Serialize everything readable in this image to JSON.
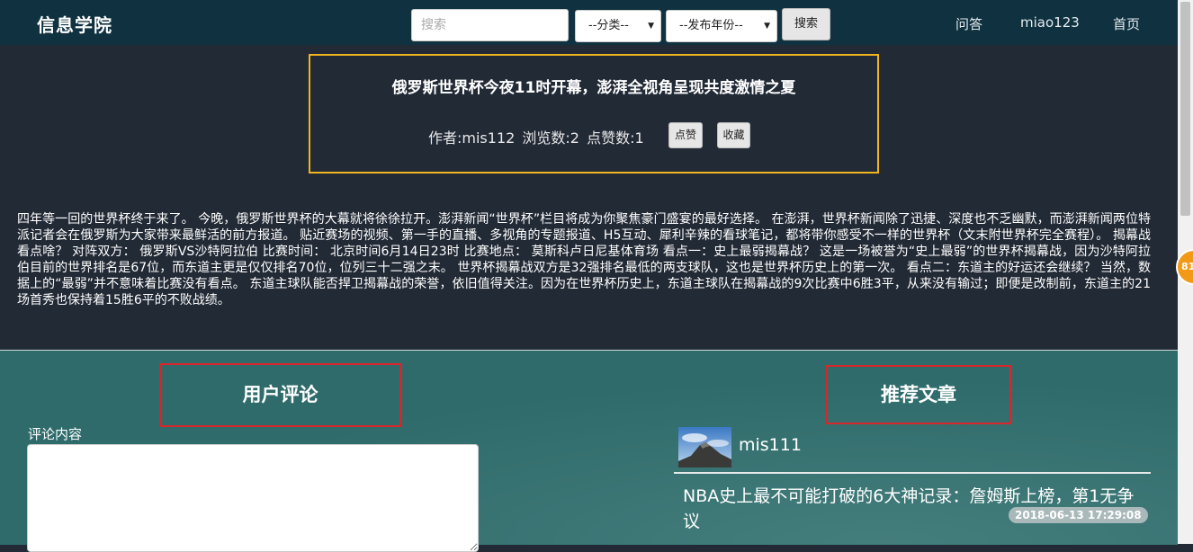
{
  "navbar": {
    "brand": "信息学院",
    "search_placeholder": "搜索",
    "category_select": "--分类--",
    "year_select": "--发布年份--",
    "search_button": "搜索",
    "links": [
      "问答",
      "miao123",
      "首页"
    ]
  },
  "article": {
    "title": "俄罗斯世界杯今夜11时开幕，澎湃全视角呈现共度激情之夏",
    "author_label": "作者:mis112",
    "views_label": "浏览数:2",
    "likes_label": "点赞数:1",
    "like_button": "点赞",
    "favorite_button": "收藏",
    "body": "四年等一回的世界杯终于来了。 今晚，俄罗斯世界杯的大幕就将徐徐拉开。澎湃新闻“世界杯”栏目将成为你聚焦豪门盛宴的最好选择。 在澎湃，世界杯新闻除了迅捷、深度也不乏幽默，而澎湃新闻两位特派记者会在俄罗斯为大家带来最鲜活的前方报道。 贴近赛场的视频、第一手的直播、多视角的专题报道、H5互动、犀利辛辣的看球笔记，都将带你感受不一样的世界杯（文末附世界杯完全赛程）。 揭幕战看点啥？ 对阵双方： 俄罗斯VS沙特阿拉伯 比赛时间： 北京时间6月14日23时 比赛地点： 莫斯科卢日尼基体育场 看点一：史上最弱揭幕战？ 这是一场被誉为“史上最弱”的世界杯揭幕战，因为沙特阿拉伯目前的世界排名是67位，而东道主更是仅仅排名70位，位列三十二强之末。 世界杯揭幕战双方是32强排名最低的两支球队，这也是世界杯历史上的第一次。 看点二：东道主的好运还会继续？ 当然，数据上的“最弱”并不意味着比赛没有看点。 东道主球队能否捍卫揭幕战的荣誉，依旧值得关注。因为在世界杯历史上，东道主球队在揭幕战的9次比赛中6胜3平，从来没有输过；即便是改制前，东道主的21场首秀也保持着15胜6平的不败战绩。"
  },
  "comments": {
    "heading": "用户评论",
    "label": "评论内容",
    "content": ""
  },
  "recommend": {
    "heading": "推荐文章",
    "author": "mis111",
    "title": "NBA史上最不可能打破的6大神记录：詹姆斯上榜，第1无争议",
    "date": "2018-06-13 17:29:08"
  },
  "floating_badge": "81",
  "colors": {
    "navbar_bg": "#0f3140",
    "page_bg": "#222a36",
    "title_box_border": "#f0b41e",
    "section_box_border": "#d9262a",
    "bottom_bg": "#2f6b6b"
  },
  "icons": [
    "caret-down-icon",
    "caret-down-icon",
    "mountain-thumbnail"
  ]
}
